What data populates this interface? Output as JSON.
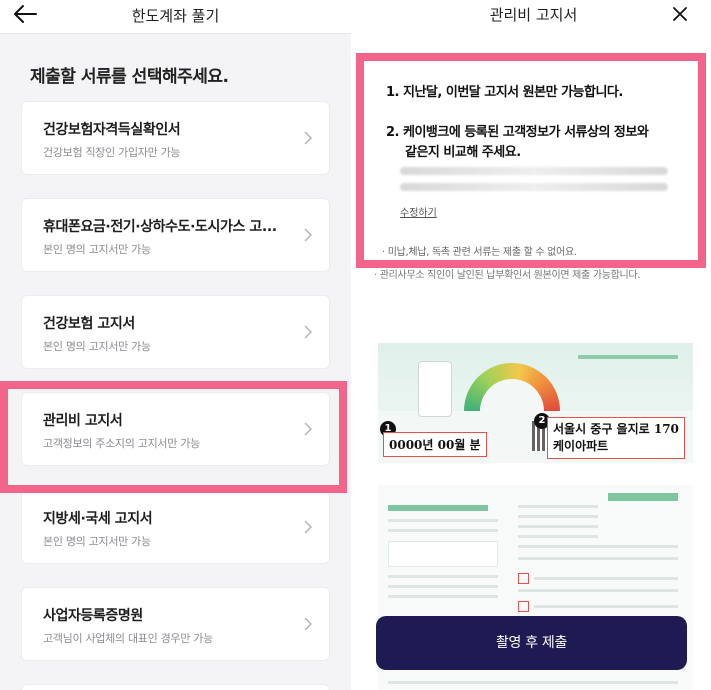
{
  "left": {
    "header_title": "한도계좌 풀기",
    "heading": "제출할 서류를 선택해주세요.",
    "documents": [
      {
        "title": "건강보험자격득실확인서",
        "subtitle": "건강보험 직장인 가입자만 가능"
      },
      {
        "title": "휴대폰요금·전기·상하수도·도시가스 고...",
        "subtitle": "본인 명의 고지서만 가능"
      },
      {
        "title": "건강보험 고지서",
        "subtitle": "본인 명의 고지서만 가능"
      },
      {
        "title": "관리비 고지서",
        "subtitle": "고객정보의 주소지의 고지서만 가능"
      },
      {
        "title": "지방세·국세 고지서",
        "subtitle": "본인 명의 고지서만 가능"
      },
      {
        "title": "사업자등록증명원",
        "subtitle": "고객님이 사업체의 대표인 경우만 가능"
      }
    ],
    "highlight_color": "#f2648a"
  },
  "right": {
    "header_title": "관리비 고지서",
    "notice": {
      "line1": "1. 지난달, 이번달 고지서 원본만 가능합니다.",
      "line2a": "2. 케이뱅크에 등록된 고객정보가 서류상의 정보와",
      "line2b": "같은지 비교해 주세요.",
      "edit_link": "수정하기"
    },
    "bullets": [
      "· 미납,체납, 독촉 관련 서류는 제출 할 수 없어요.",
      "· 관리사무소 직인이 날인된 납부확인서 원본이면 제출 가능합니다."
    ],
    "sample": {
      "marker1": "1",
      "marker2": "2",
      "date_box": "0000년 00월 분",
      "address_line1": "서울시 중구 을지로 170",
      "address_line2": "케이아파트"
    },
    "cta_label": "촬영 후 제출"
  },
  "colors": {
    "accent_pink": "#f2648a",
    "cta_navy": "#1e1b53"
  }
}
